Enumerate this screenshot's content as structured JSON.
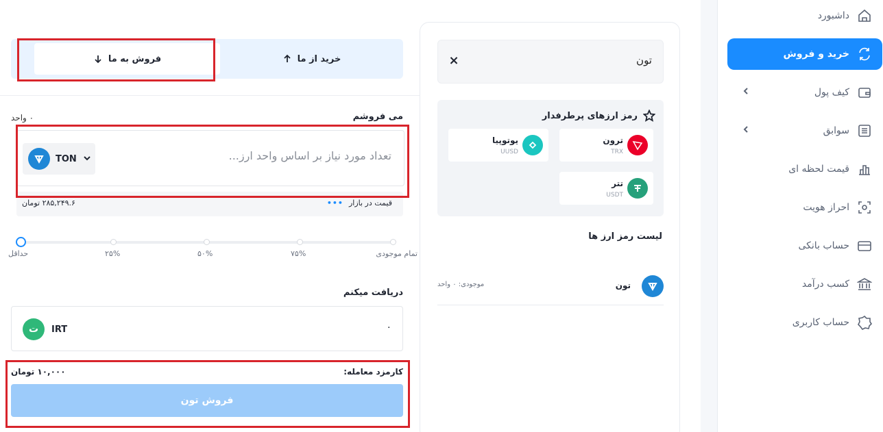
{
  "sidebar": {
    "items": [
      {
        "label": "داشبورد",
        "icon": "home-icon"
      },
      {
        "label": "خرید و فروش",
        "icon": "exchange-icon"
      },
      {
        "label": "کیف پول",
        "icon": "wallet-icon"
      },
      {
        "label": "سوابق",
        "icon": "history-icon"
      },
      {
        "label": "قیمت لحظه ای",
        "icon": "chart-icon"
      },
      {
        "label": "احراز هویت",
        "icon": "identity-icon"
      },
      {
        "label": "حساب بانکی",
        "icon": "card-icon"
      },
      {
        "label": "کسب درآمد",
        "icon": "bank-icon"
      },
      {
        "label": "حساب کاربری",
        "icon": "user-icon"
      }
    ]
  },
  "search": {
    "value": "تون",
    "clear": "×"
  },
  "popular": {
    "title": "رمز ارزهای پرطرفدار",
    "coins": [
      {
        "name": "ترون",
        "symbol": "TRX",
        "color": "#eb0029"
      },
      {
        "name": "یوتوپیا",
        "symbol": "UUSD",
        "color": "#1bc6c0"
      },
      {
        "name": "تتر",
        "symbol": "USDT",
        "color": "#26a17b"
      }
    ]
  },
  "list": {
    "title": "لیست رمز ارز ها",
    "rows": [
      {
        "name": "تون",
        "balance": "موجودی: ۰ واحد"
      }
    ]
  },
  "trade": {
    "tabs": {
      "sell": "فروش به ما",
      "buy": "خرید از ما"
    },
    "sell_label": "می فروشم",
    "unit": "۰ واحد",
    "amount_placeholder": "تعداد مورد نیاز بر اساس واحد ارز...",
    "currency": "TON",
    "market_label": "قیمت در بازار",
    "market_price": "۲۸۵,۲۴۹.۶ تومان",
    "slider": {
      "labels": [
        "تمام موجودی",
        "۷۵%",
        "۵۰%",
        "۲۵%",
        "حداقل"
      ],
      "value_fraction": 0
    },
    "receive_label": "دریافت میکنم",
    "receive_value": "۰",
    "receive_currency": "IRT",
    "irt_glyph": "ت",
    "fee_label": "کارمزد معامله:",
    "fee_value": "۱۰,۰۰۰ تومان",
    "submit": "فروش تون"
  },
  "colors": {
    "accent": "#1a8cff",
    "highlight": "#d8242b",
    "ton": "#1f87d6"
  }
}
